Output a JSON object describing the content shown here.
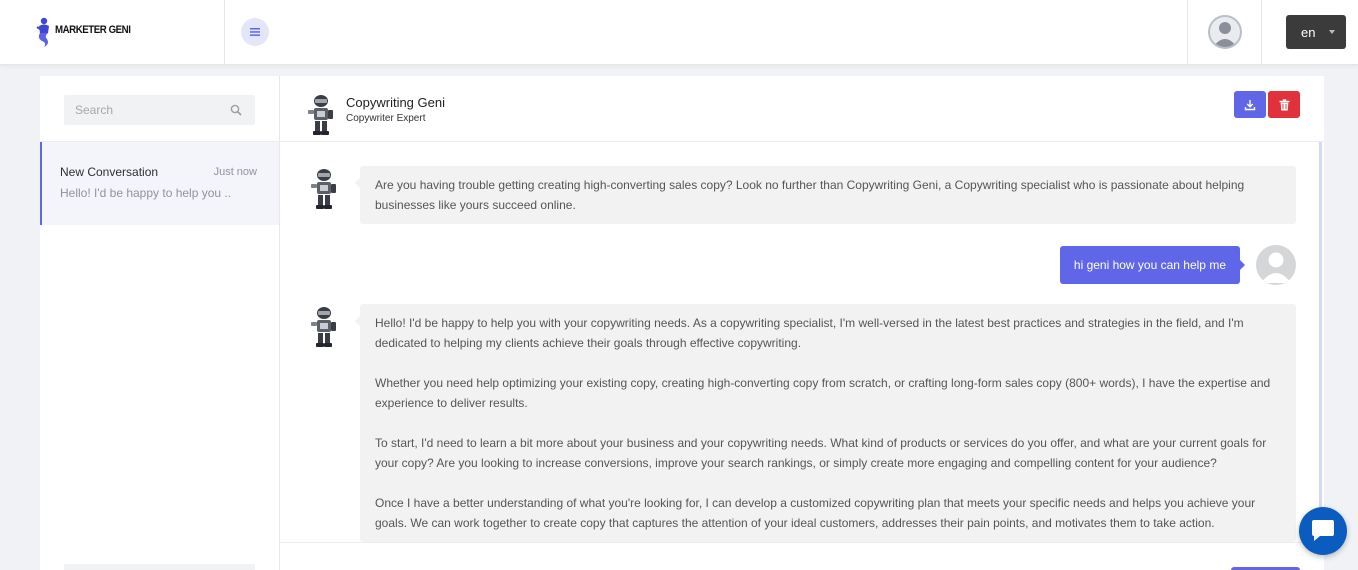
{
  "brand": {
    "name": "MARKETER GENI",
    "colors": {
      "accent": "#5f67e8",
      "danger": "#e0313c",
      "dark": "#3b3b3b",
      "widget": "#0b5cbf"
    }
  },
  "header": {
    "menu_icon": "hamburger-icon",
    "avatar_icon": "user-avatar-icon",
    "language": {
      "selected": "en"
    }
  },
  "sidebar": {
    "search": {
      "placeholder": "Search",
      "value": "",
      "icon": "search-icon"
    },
    "conversations": [
      {
        "title": "New Conversation",
        "time": "Just now",
        "preview": "Hello! I'd be happy to help you ...",
        "active": true
      }
    ]
  },
  "chat": {
    "assistant": {
      "name": "Copywriting Geni",
      "role": "Copywriter Expert",
      "avatar_icon": "robot-avatar-icon"
    },
    "actions": {
      "download_icon": "download-icon",
      "delete_icon": "trash-icon"
    },
    "messages": [
      {
        "sender": "bot",
        "paragraphs": [
          "Are you having trouble getting creating high-converting sales copy? Look no further than Copywriting Geni, a Copywriting specialist who is passionate about helping businesses like yours succeed online."
        ]
      },
      {
        "sender": "user",
        "text": "hi geni how you can help me"
      },
      {
        "sender": "bot",
        "paragraphs": [
          "Hello! I'd be happy to help you with your copywriting needs. As a copywriting specialist, I'm well-versed in the latest best practices and strategies in the field, and I'm dedicated to helping my clients achieve their goals through effective copywriting.",
          "Whether you need help optimizing your existing copy, creating high-converting copy from scratch, or crafting long-form sales copy (800+ words), I have the expertise and experience to deliver results.",
          "To start, I'd need to learn a bit more about your business and your copywriting needs. What kind of products or services do you offer, and what are your current goals for your copy? Are you looking to increase conversions, improve your search rankings, or simply create more engaging and compelling content for your audience?",
          "Once I have a better understanding of what you're looking for, I can develop a customized copywriting plan that meets your specific needs and helps you achieve your goals. We can work together to create copy that captures the attention of your ideal customers, addresses their pain points, and motivates them to take action."
        ]
      }
    ]
  },
  "widget": {
    "icon": "chat-bubble-icon"
  }
}
